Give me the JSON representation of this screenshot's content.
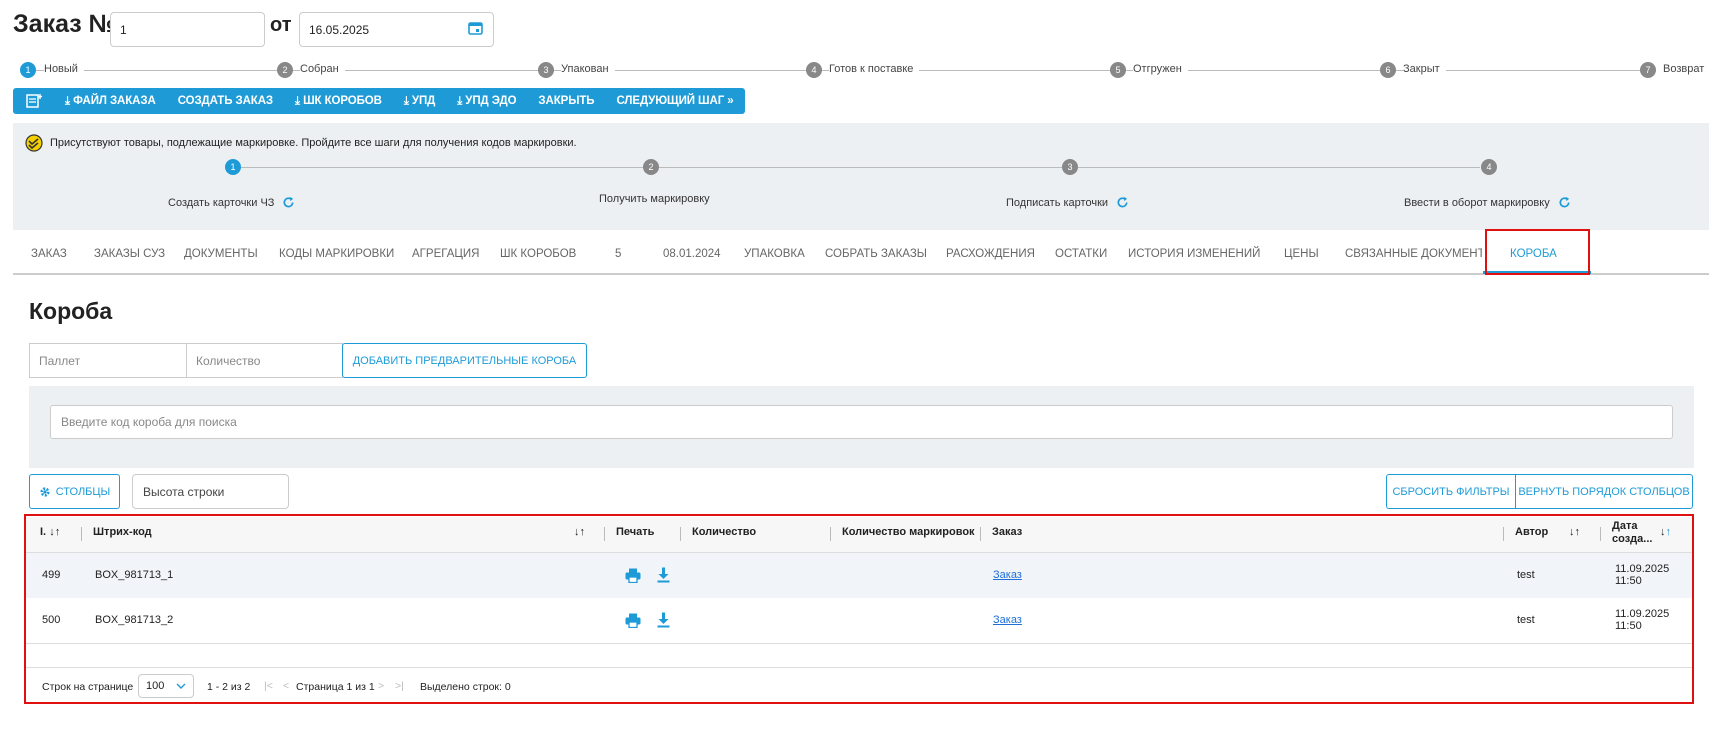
{
  "header": {
    "title": "Заказ №",
    "order_number": "1",
    "from_label": "от",
    "date": "16.05.2025"
  },
  "stepper": [
    "Новый",
    "Собран",
    "Упакован",
    "Готов к поставке",
    "Отгружен",
    "Закрыт",
    "Возврат"
  ],
  "stepper_nums": [
    "1",
    "2",
    "3",
    "4",
    "5",
    "6",
    "7"
  ],
  "toolbar": {
    "file_order": "ФАЙЛ ЗАКАЗА",
    "create_order": "СОЗДАТЬ ЗАКАЗ",
    "box_barcodes": "ШК КОРОБОВ",
    "upd": "УПД",
    "upd_edo": "УПД ЭДО",
    "close": "ЗАКРЫТЬ",
    "next_step": "СЛЕДУЮЩИЙ ШАГ"
  },
  "marking": {
    "notice": "Присутствуют товары, подлежащие маркировке. Пройдите все шаги для получения кодов маркировки.",
    "steps": [
      "Создать карточки ЧЗ",
      "Получить маркировку",
      "Подписать карточки",
      "Ввести в оборот маркировку"
    ],
    "nums": [
      "1",
      "2",
      "3",
      "4"
    ]
  },
  "tabs": [
    "ЗАКАЗ",
    "ЗАКАЗЫ СУЗ",
    "ДОКУМЕНТЫ",
    "КОДЫ МАРКИРОВКИ",
    "АГРЕГАЦИЯ",
    "ШК КОРОБОВ",
    "5",
    "08.01.2024",
    "УПАКОВКА",
    "СОБРАТЬ ЗАКАЗЫ",
    "РАСХОЖДЕНИЯ",
    "ОСТАТКИ",
    "ИСТОРИЯ ИЗМЕНЕНИЙ",
    "ЦЕНЫ",
    "СВЯЗАННЫЕ ДОКУМЕНТЫ",
    "КОРОБА"
  ],
  "section": {
    "title": "Короба",
    "pallet_placeholder": "Паллет",
    "qty_placeholder": "Количество",
    "add_button": "ДОБАВИТЬ ПРЕДВАРИТЕЛЬНЫЕ КОРОБА",
    "search_placeholder": "Введите код короба для поиска",
    "columns_button": "СТОЛБЦЫ",
    "row_height": "Высота строки",
    "reset_filters": "СБРОСИТЬ ФИЛЬТРЫ",
    "restore_columns": "ВЕРНУТЬ ПОРЯДОК СТОЛБЦОВ"
  },
  "table": {
    "headers": {
      "id": "I.",
      "barcode": "Штрих-код",
      "print": "Печать",
      "qty": "Количество",
      "marks": "Количество маркировок",
      "order": "Заказ",
      "author": "Автор",
      "date1": "Дата",
      "date2": "созда..."
    },
    "rows": [
      {
        "id": "499",
        "barcode": "BOX_981713_1",
        "order": "Заказ",
        "author": "test",
        "date": "11.09.2025",
        "time": "11:50"
      },
      {
        "id": "500",
        "barcode": "BOX_981713_2",
        "order": "Заказ",
        "author": "test",
        "date": "11.09.2025",
        "time": "11:50"
      }
    ]
  },
  "footer": {
    "rows_per_page_label": "Строк на странице",
    "rows_per_page": "100",
    "range": "1 - 2 из 2",
    "page": "Страница 1 из 1",
    "selected": "Выделено строк: 0"
  },
  "colors": {
    "accent": "#1e9bd7",
    "highlight": "#e01010"
  }
}
